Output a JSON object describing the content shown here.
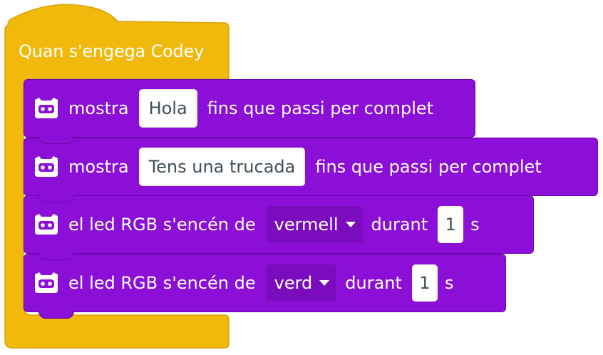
{
  "hat": {
    "label": "Quan s'engega Codey"
  },
  "blocks": [
    {
      "icon": "codey-robot-icon",
      "text_before": "mostra",
      "input": "Hola",
      "text_after": "fins que passi per complet"
    },
    {
      "icon": "codey-robot-icon",
      "text_before": "mostra",
      "input": "Tens una trucada",
      "text_after": "fins que passi per complet"
    },
    {
      "icon": "codey-robot-icon",
      "text_before": "el led RGB s'encén de",
      "dropdown": "vermell",
      "text_middle": "durant",
      "number": "1",
      "unit": "s"
    },
    {
      "icon": "codey-robot-icon",
      "text_before": "el led RGB s'encén de",
      "dropdown": "verd",
      "text_middle": "durant",
      "number": "1",
      "unit": "s"
    }
  ],
  "colors": {
    "event_block": "#f0b90b",
    "event_block_border": "#d9a308",
    "codey_block": "#8b0fd6",
    "codey_block_border": "#6a07aa",
    "dropdown_fill": "#7a0cbd",
    "input_text": "#3f4f58"
  }
}
